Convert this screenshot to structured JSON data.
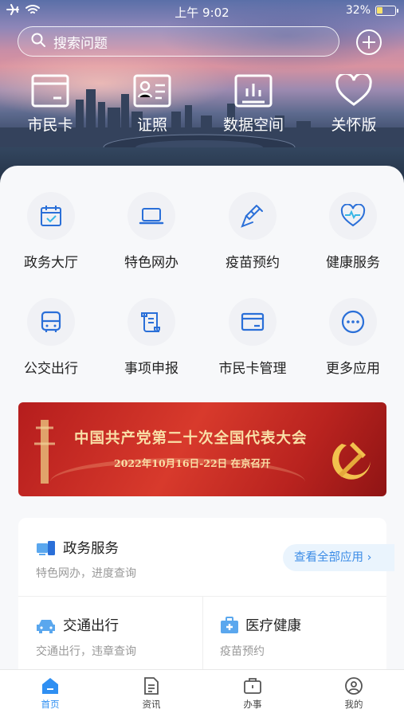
{
  "status_bar": {
    "time": "上午 9:02",
    "battery": "32%",
    "battery_level": 0.32
  },
  "search": {
    "placeholder": "搜索问题"
  },
  "quick_actions": [
    {
      "label": "市民卡",
      "icon": "card-icon"
    },
    {
      "label": "证照",
      "icon": "id-card-icon"
    },
    {
      "label": "数据空间",
      "icon": "data-chart-icon"
    },
    {
      "label": "关怀版",
      "icon": "heart-icon"
    }
  ],
  "services": [
    {
      "label": "政务大厅",
      "icon": "calendar-check-icon"
    },
    {
      "label": "特色网办",
      "icon": "laptop-icon"
    },
    {
      "label": "疫苗预约",
      "icon": "syringe-icon"
    },
    {
      "label": "健康服务",
      "icon": "heart-pulse-icon"
    },
    {
      "label": "公交出行",
      "icon": "bus-icon"
    },
    {
      "label": "事项申报",
      "icon": "scroll-icon"
    },
    {
      "label": "市民卡管理",
      "icon": "card-icon"
    },
    {
      "label": "更多应用",
      "icon": "more-icon"
    }
  ],
  "banner": {
    "title": "中国共产党第二十次全国代表大会",
    "subtitle": "2022年10月16日-22日 在京召开"
  },
  "panel": {
    "gov": {
      "title": "政务服务",
      "subtitle": "特色网办，进度查询",
      "view_all": "查看全部应用"
    },
    "traffic": {
      "title": "交通出行",
      "subtitle": "交通出行，违章查询"
    },
    "medical": {
      "title": "医疗健康",
      "subtitle": "疫苗预约"
    }
  },
  "tabs": [
    {
      "label": "首页",
      "icon": "home-icon",
      "active": true
    },
    {
      "label": "资讯",
      "icon": "news-icon",
      "active": false
    },
    {
      "label": "办事",
      "icon": "briefcase-icon",
      "active": false
    },
    {
      "label": "我的",
      "icon": "user-icon",
      "active": false
    }
  ],
  "colors": {
    "accent": "#2f8ff2",
    "icon_blue": "#2a6fd8",
    "banner_red": "#c52b24"
  }
}
